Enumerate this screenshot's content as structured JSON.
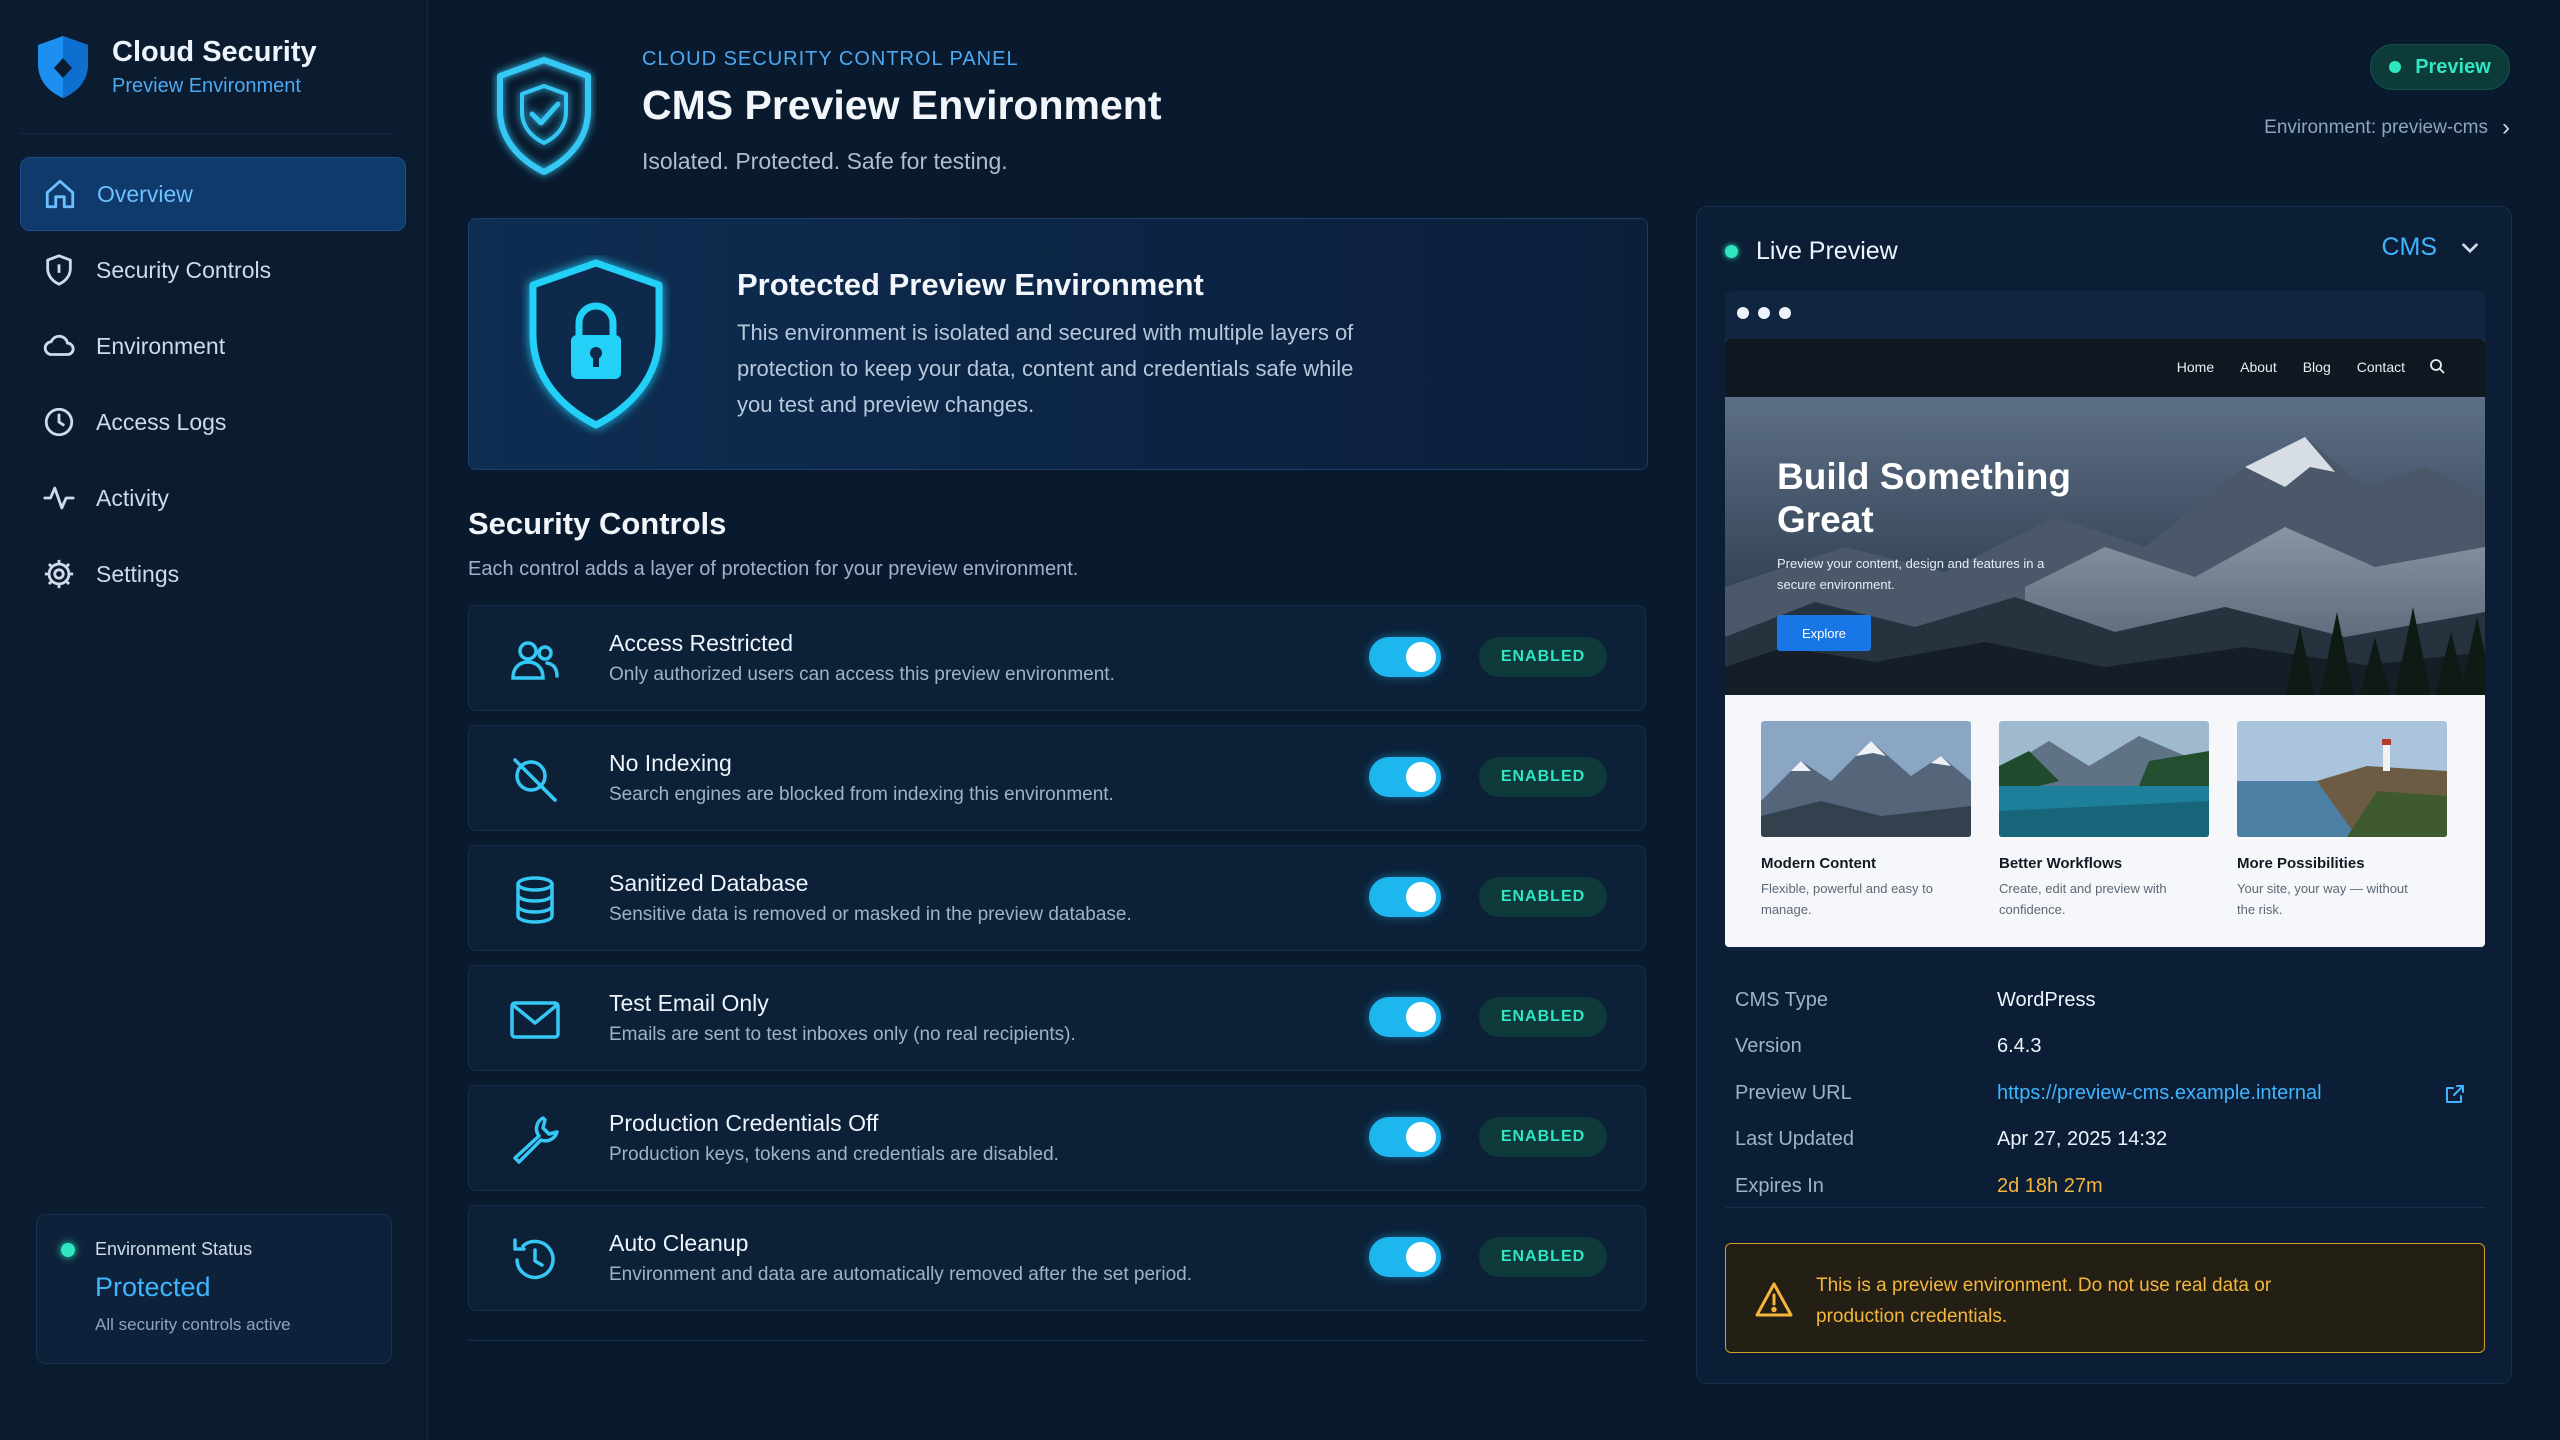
{
  "brand": {
    "title": "Cloud Security",
    "subtitle": "Preview Environment"
  },
  "sidebar": {
    "items": [
      {
        "label": "Overview",
        "icon": "home-icon",
        "active": true
      },
      {
        "label": "Security Controls",
        "icon": "shield-icon"
      },
      {
        "label": "Environment",
        "icon": "cloud-icon"
      },
      {
        "label": "Access Logs",
        "icon": "clock-icon"
      },
      {
        "label": "Activity",
        "icon": "activity-icon"
      },
      {
        "label": "Settings",
        "icon": "gear-icon"
      }
    ],
    "status": {
      "label": "Environment Status",
      "value": "Protected",
      "note": "All security controls active"
    }
  },
  "header": {
    "eyebrow": "CLOUD SECURITY CONTROL PANEL",
    "title": "CMS Preview Environment",
    "subtitle": "Isolated. Protected. Safe for testing.",
    "badge": "Preview",
    "env_link": "Environment: preview-cms"
  },
  "hero": {
    "title": "Protected Preview Environment",
    "description": "This environment is isolated and secured with multiple layers of protection to keep your data, content and credentials safe while you test and preview changes."
  },
  "security": {
    "title": "Security Controls",
    "subtitle": "Each control adds a layer of protection for your preview environment.",
    "controls": [
      {
        "title": "Access Restricted",
        "desc": "Only authorized users can access this preview environment.",
        "status": "ENABLED",
        "enabled": true,
        "icon": "users-icon"
      },
      {
        "title": "No Indexing",
        "desc": "Search engines are blocked from indexing this environment.",
        "status": "ENABLED",
        "enabled": true,
        "icon": "no-search-icon"
      },
      {
        "title": "Sanitized Database",
        "desc": "Sensitive data is removed or masked in the preview database.",
        "status": "ENABLED",
        "enabled": true,
        "icon": "database-icon"
      },
      {
        "title": "Test Email Only",
        "desc": "Emails are sent to test inboxes only (no real recipients).",
        "status": "ENABLED",
        "enabled": true,
        "icon": "mail-icon"
      },
      {
        "title": "Production Credentials Off",
        "desc": "Production keys, tokens and credentials are disabled.",
        "status": "ENABLED",
        "enabled": true,
        "icon": "wrench-icon"
      },
      {
        "title": "Auto Cleanup",
        "desc": "Environment and data are automatically removed after the set period.",
        "status": "ENABLED",
        "enabled": true,
        "icon": "history-icon"
      }
    ]
  },
  "preview": {
    "title": "Live Preview",
    "cms_select": "CMS",
    "site": {
      "nav": [
        "Home",
        "About",
        "Blog",
        "Contact"
      ],
      "hero_title": "Build Something Great",
      "hero_text": "Preview your content, design and features in a secure environment.",
      "hero_button": "Explore",
      "cards": [
        {
          "title": "Modern Content",
          "desc": "Flexible, powerful and easy to manage."
        },
        {
          "title": "Better Workflows",
          "desc": "Create, edit and preview with confidence."
        },
        {
          "title": "More Possibilities",
          "desc": "Your site, your way — without the risk."
        }
      ]
    },
    "meta": [
      {
        "key": "CMS Type",
        "value": "WordPress"
      },
      {
        "key": "Version",
        "value": "6.4.3"
      },
      {
        "key": "Preview URL",
        "value": "https://preview-cms.example.internal"
      },
      {
        "key": "Last Updated",
        "value": "Apr 27, 2025 14:32"
      },
      {
        "key": "Expires In",
        "value": "2d 18h 27m"
      }
    ],
    "warning": "This is a preview environment. Do not use real data or production credentials."
  },
  "colors": {
    "accent": "#3fb5ff",
    "success": "#2ee6c0",
    "warning": "#f5b73b",
    "background": "#0a1a2e"
  }
}
